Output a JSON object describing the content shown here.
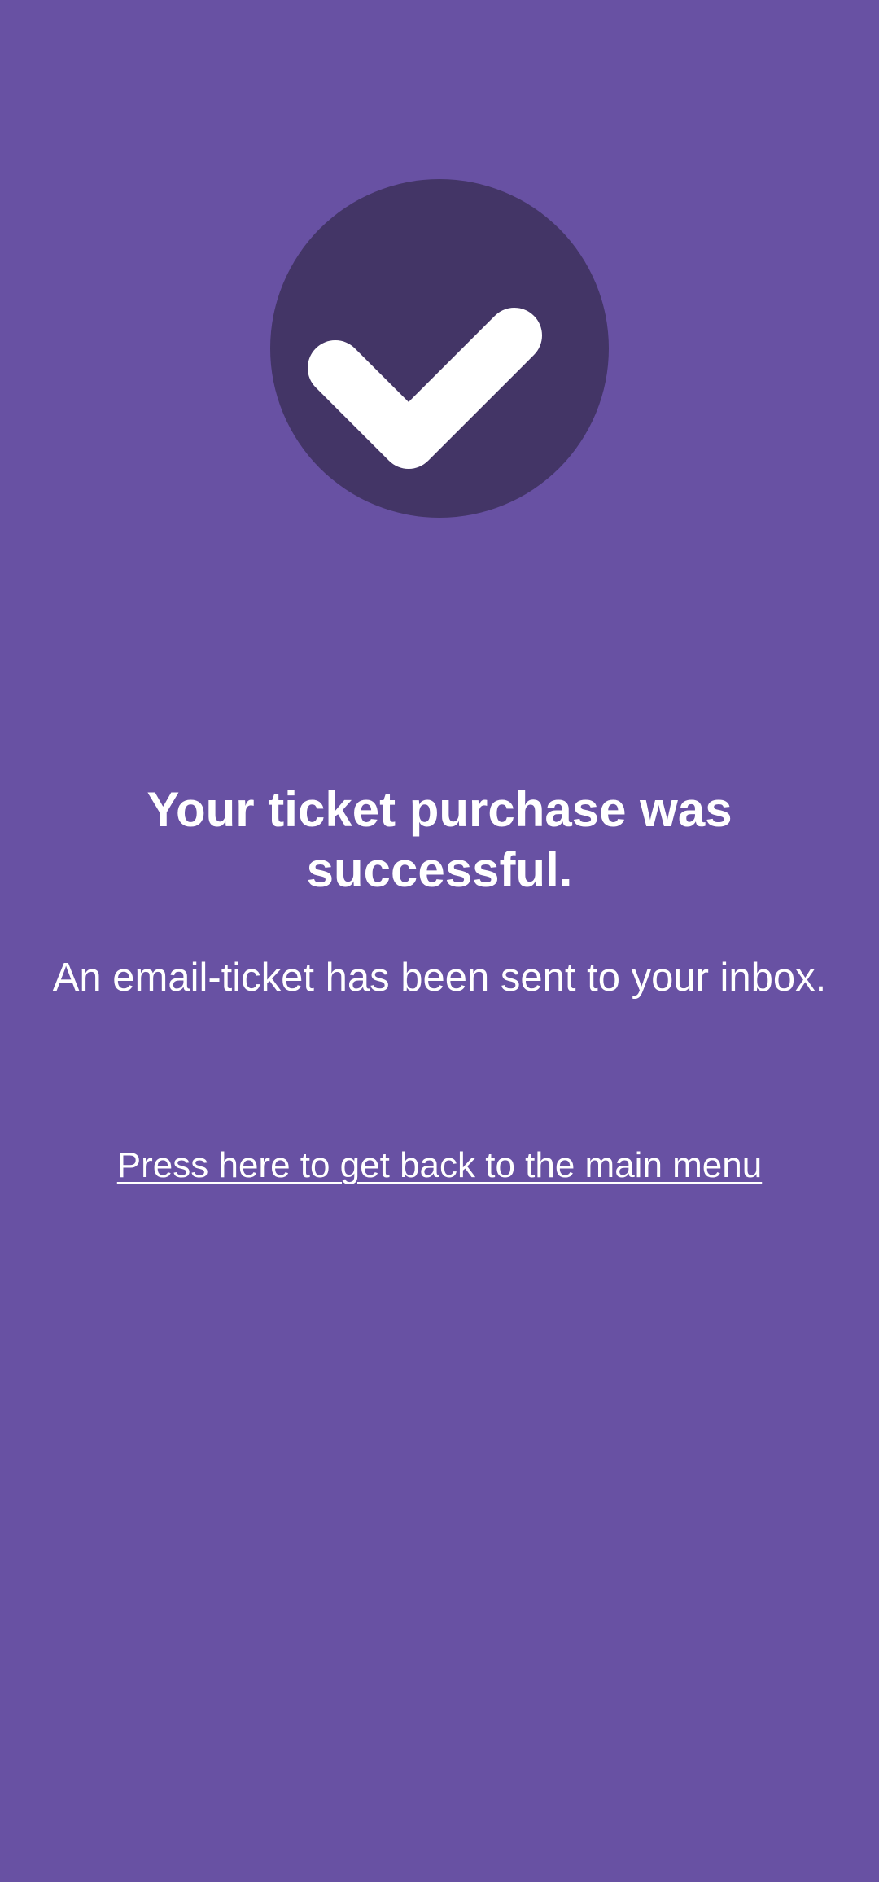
{
  "success": {
    "icon": "checkmark-icon",
    "badge_color": "#433566",
    "check_color": "#ffffff",
    "headline": "Your ticket purchase was successful.",
    "message": "An email-ticket has been sent to your inbox."
  },
  "navigation": {
    "back_link_label": "Press here to get back to the main menu"
  },
  "theme": {
    "background": "#6851a3",
    "text": "#ffffff"
  }
}
